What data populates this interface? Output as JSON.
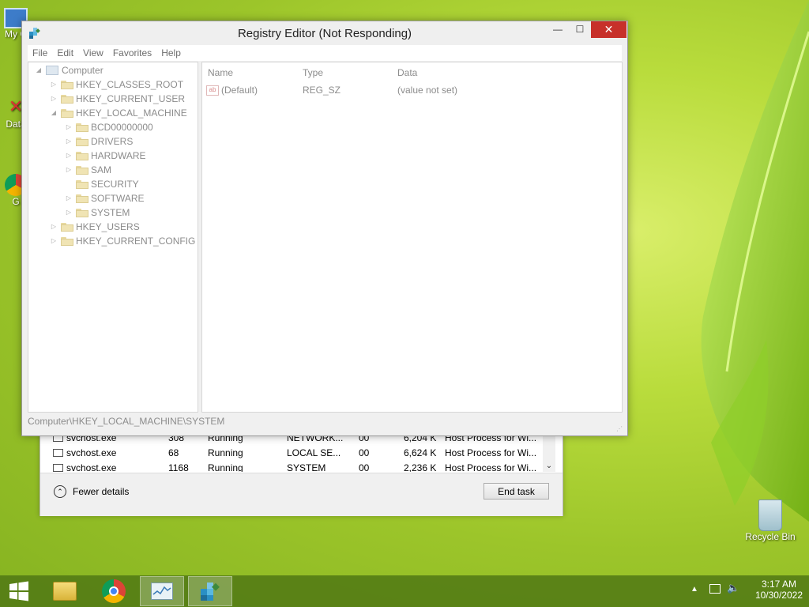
{
  "desktop": {
    "icons": [
      {
        "label": "My C",
        "icon": "computer-icon"
      },
      {
        "label": "Data",
        "icon": "shortcut-icon"
      },
      {
        "label": "G",
        "icon": "chrome-icon"
      },
      {
        "label": "Recycle Bin",
        "icon": "recycle-bin-icon"
      }
    ]
  },
  "regedit": {
    "title": "Registry Editor (Not Responding)",
    "menu": [
      "File",
      "Edit",
      "View",
      "Favorites",
      "Help"
    ],
    "tree": [
      {
        "label": "Computer",
        "level": 0,
        "expander": "◢"
      },
      {
        "label": "HKEY_CLASSES_ROOT",
        "level": 1,
        "expander": "▷"
      },
      {
        "label": "HKEY_CURRENT_USER",
        "level": 1,
        "expander": "▷"
      },
      {
        "label": "HKEY_LOCAL_MACHINE",
        "level": 1,
        "expander": "◢"
      },
      {
        "label": "BCD00000000",
        "level": 2,
        "expander": "▷"
      },
      {
        "label": "DRIVERS",
        "level": 2,
        "expander": "▷"
      },
      {
        "label": "HARDWARE",
        "level": 2,
        "expander": "▷"
      },
      {
        "label": "SAM",
        "level": 2,
        "expander": "▷"
      },
      {
        "label": "SECURITY",
        "level": 2,
        "expander": ""
      },
      {
        "label": "SOFTWARE",
        "level": 2,
        "expander": "▷"
      },
      {
        "label": "SYSTEM",
        "level": 2,
        "expander": "▷"
      },
      {
        "label": "HKEY_USERS",
        "level": 1,
        "expander": "▷"
      },
      {
        "label": "HKEY_CURRENT_CONFIG",
        "level": 1,
        "expander": "▷"
      }
    ],
    "columns": {
      "name": "Name",
      "type": "Type",
      "data": "Data"
    },
    "values": [
      {
        "name": "(Default)",
        "type": "REG_SZ",
        "data": "(value not set)"
      }
    ],
    "status": "Computer\\HKEY_LOCAL_MACHINE\\SYSTEM"
  },
  "taskmgr": {
    "rows": [
      {
        "name": "svchost.exe",
        "pid": "308",
        "status": "Running",
        "user": "NETWORK...",
        "cpu": "00",
        "mem": "6,204 K",
        "desc": "Host Process for Wi..."
      },
      {
        "name": "svchost.exe",
        "pid": "68",
        "status": "Running",
        "user": "LOCAL SE...",
        "cpu": "00",
        "mem": "6,624 K",
        "desc": "Host Process for Wi..."
      },
      {
        "name": "svchost.exe",
        "pid": "1168",
        "status": "Running",
        "user": "SYSTEM",
        "cpu": "00",
        "mem": "2,236 K",
        "desc": "Host Process for Wi..."
      }
    ],
    "fewer_details": "Fewer details",
    "end_task": "End task"
  },
  "taskbar": {
    "items": [
      "start-icon",
      "file-explorer-icon",
      "chrome-icon",
      "task-manager-icon",
      "registry-editor-icon"
    ],
    "time": "3:17 AM",
    "date": "10/30/2022"
  }
}
